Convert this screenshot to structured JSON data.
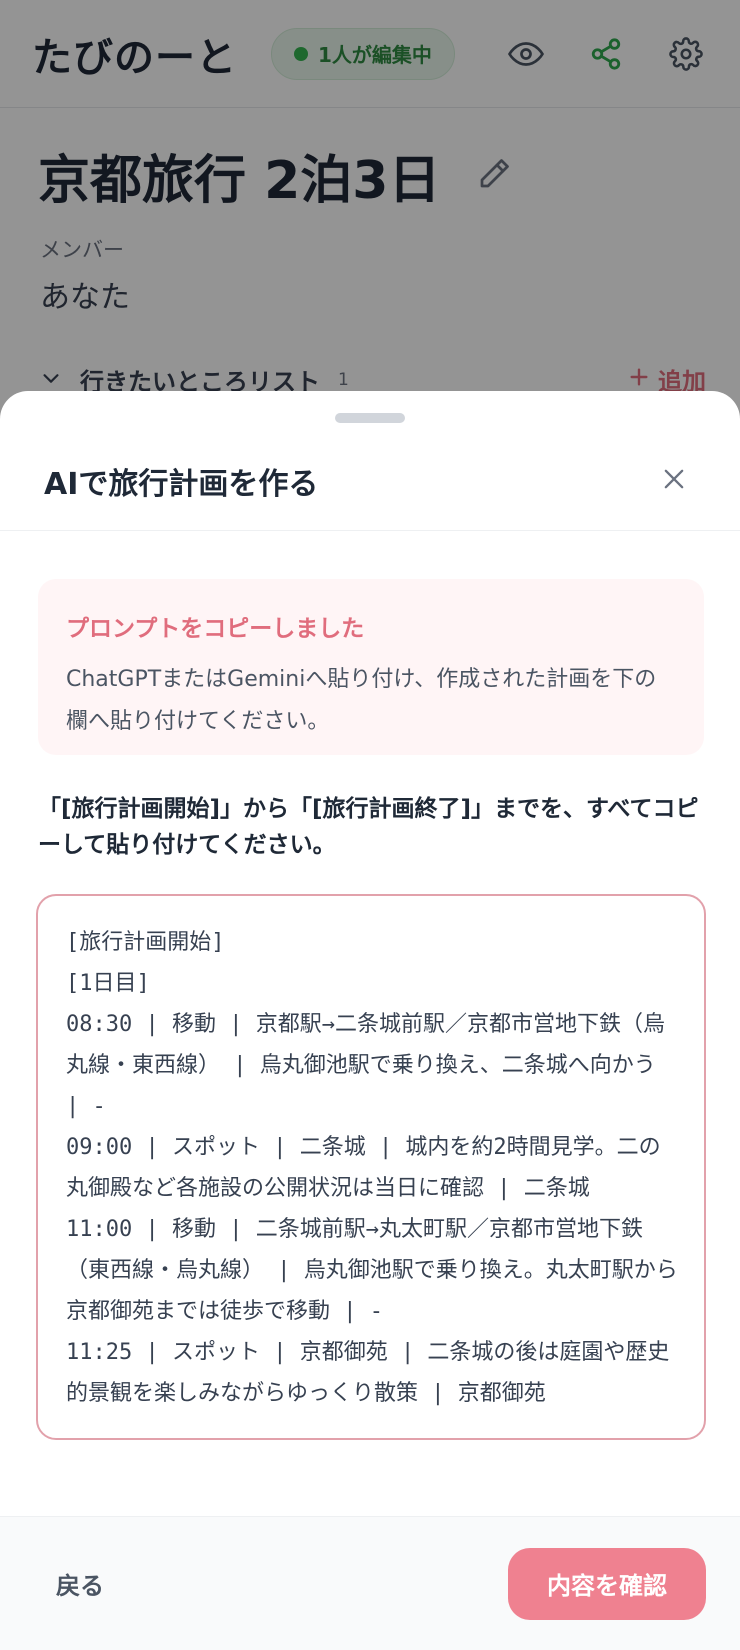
{
  "app": {
    "logo": "たびのーと",
    "editing_badge": "1人が編集中"
  },
  "trip": {
    "title": "京都旅行 2泊3日",
    "members_label": "メンバー",
    "members_value": "あなた",
    "wishlist_label": "行きたいところリスト",
    "wishlist_count": "1",
    "wishlist_add": "追加"
  },
  "sheet": {
    "title": "AIで旅行計画を作る",
    "notice_title": "プロンプトをコピーしました",
    "notice_body": "ChatGPTまたはGeminiへ貼り付け、作成された計画を下の欄へ貼り付けてください。",
    "instruction": "「[旅行計画開始]」から「[旅行計画終了]」までを、すべてコピーして貼り付けてください。",
    "plan_text": "[旅行計画開始]\n[1日目]\n08:30 | 移動 | 京都駅→二条城前駅／京都市営地下鉄（烏丸線・東西線） | 烏丸御池駅で乗り換え、二条城へ向かう | -\n09:00 | スポット | 二条城 | 城内を約2時間見学。二の丸御殿など各施設の公開状況は当日に確認 | 二条城\n11:00 | 移動 | 二条城前駅→丸太町駅／京都市営地下鉄（東西線・烏丸線） | 烏丸御池駅で乗り換え。丸太町駅から京都御苑までは徒歩で移動 | -\n11:25 | スポット | 京都御苑 | 二条城の後は庭園や歴史的景観を楽しみながらゆっくり散策 | 京都御苑",
    "back_label": "戻る",
    "confirm_label": "内容を確認"
  },
  "colors": {
    "accent": "#ef8190",
    "accent_text": "#e06d7d",
    "badge_green": "#2f8a43",
    "share_green": "#2fa84f"
  },
  "icons": [
    "eye-icon",
    "share-icon",
    "gear-icon",
    "pencil-icon",
    "chevron-down-icon",
    "plus-icon",
    "close-icon"
  ]
}
